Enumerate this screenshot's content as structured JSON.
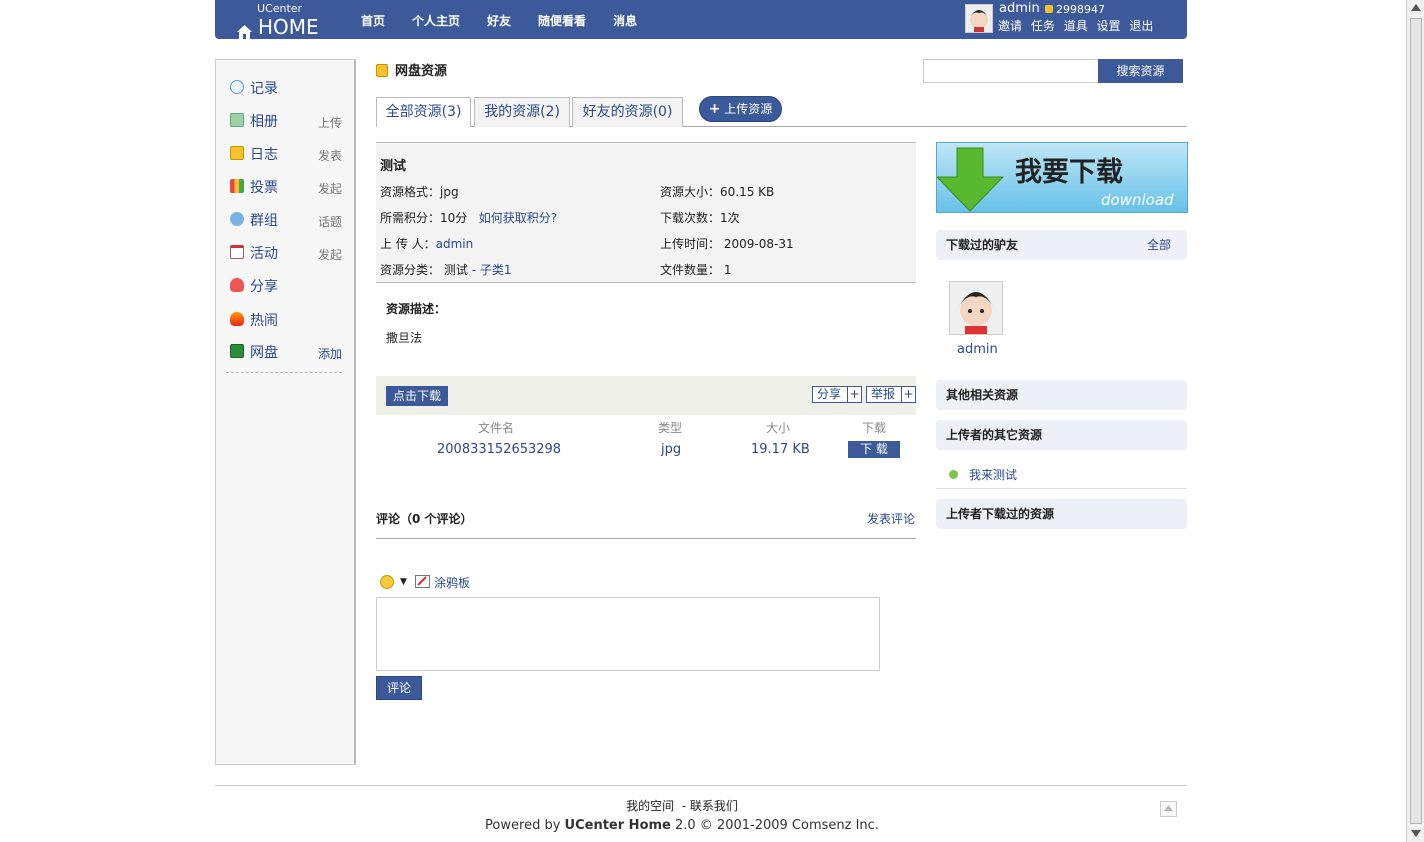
{
  "header": {
    "logo_top": "UCenter",
    "logo_main": "HOME",
    "nav": [
      "首页",
      "个人主页",
      "好友",
      "随便看看",
      "消息"
    ],
    "username": "admin",
    "credits": "2998947",
    "links": [
      "邀请",
      "任务",
      "道具",
      "设置",
      "退出"
    ]
  },
  "sidebar": {
    "items": [
      {
        "label": "记录",
        "action": ""
      },
      {
        "label": "相册",
        "action": "上传"
      },
      {
        "label": "日志",
        "action": "发表"
      },
      {
        "label": "投票",
        "action": "发起"
      },
      {
        "label": "群组",
        "action": "话题"
      },
      {
        "label": "活动",
        "action": "发起"
      },
      {
        "label": "分享",
        "action": ""
      },
      {
        "label": "热闹",
        "action": ""
      },
      {
        "label": "网盘",
        "action": "添加"
      }
    ]
  },
  "page": {
    "title": "网盘资源",
    "search_button": "搜索资源",
    "tabs": [
      "全部资源(3)",
      "我的资源(2)",
      "好友的资源(0)"
    ],
    "upload_button": "上传资源"
  },
  "resource": {
    "title": "测试",
    "format_label": "资源格式：",
    "format_value": "jpg",
    "size_label": "资源大小：",
    "size_value": "60.15 KB",
    "points_label": "所需积分：",
    "points_value": "10分",
    "points_link": "如何获取积分?",
    "downloads_label": "下载次数：",
    "downloads_value": "1次",
    "uploader_label": "上 传 人：",
    "uploader_value": "admin",
    "upload_time_label": "上传时间：",
    "upload_time_value": "2009-08-31",
    "category_label": "资源分类：",
    "category_value": "测试",
    "category_sub": "- 子类1",
    "file_count_label": "文件数量：",
    "file_count_value": "1",
    "desc_heading": "资源描述：",
    "desc_text": "撒旦法"
  },
  "download_bar": {
    "download_button": "点击下载",
    "share_button": "分享",
    "report_button": "举报",
    "columns": [
      "文件名",
      "类型",
      "大小",
      "下载"
    ],
    "row": {
      "filename": "200833152653298",
      "type": "jpg",
      "size": "19.17 KB",
      "action": "下 载"
    }
  },
  "comments": {
    "heading": "评论（0 个评论）",
    "post_link": "发表评论",
    "tuya": "涂鸦板",
    "submit": "评论"
  },
  "right": {
    "banner_main": "我要下载",
    "banner_sub": "download",
    "downloaded_friends": "下载过的驴友",
    "all_link": "全部",
    "friend_name": "admin",
    "related": "其他相关资源",
    "uploader_other": "上传者的其它资源",
    "uploader_other_item": "我来测试",
    "uploader_downloaded": "上传者下载过的资源"
  },
  "footer": {
    "my_space": "我的空间",
    "contact": "- 联系我们",
    "powered_prefix": "Powered by",
    "product": "UCenter Home",
    "version": "2.0 © 2001-2009 Comsenz Inc."
  }
}
